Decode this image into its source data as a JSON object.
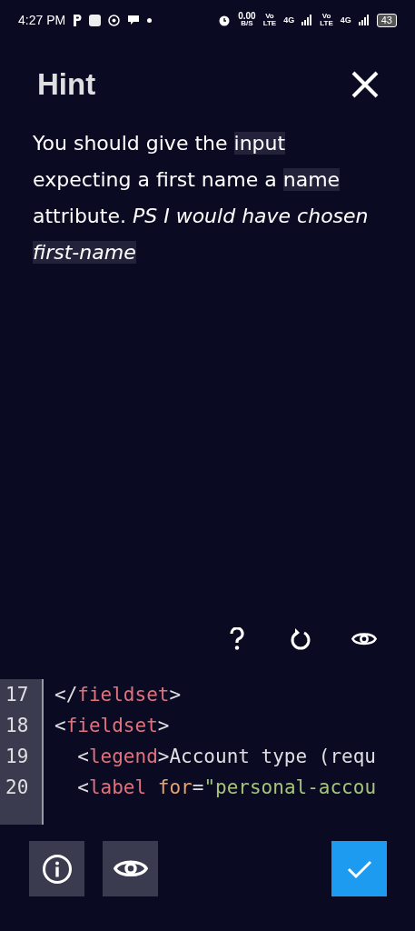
{
  "status_bar": {
    "time": "4:27 PM",
    "speed": "0.00",
    "speed_unit": "B/S",
    "sim_1": {
      "vo": "Vo",
      "lte": "LTE",
      "net": "4G"
    },
    "sim_2": {
      "vo": "Vo",
      "lte": "LTE",
      "net": "4G"
    },
    "battery": "43"
  },
  "hint": {
    "title": "Hint",
    "segments": [
      {
        "kind": "plain",
        "text": "You should give the "
      },
      {
        "kind": "code",
        "text": "input"
      },
      {
        "kind": "plain",
        "text": " expecting a first name a "
      },
      {
        "kind": "code",
        "text": "name"
      },
      {
        "kind": "plain",
        "text": " attribute. "
      },
      {
        "kind": "italic",
        "text": "PS I would have chosen "
      },
      {
        "kind": "italic-code",
        "text": "first-name"
      }
    ]
  },
  "editor": {
    "lines": [
      {
        "number": "17",
        "tokens": [
          {
            "kind": "punct",
            "text": "</"
          },
          {
            "kind": "tag",
            "text": "fieldset"
          },
          {
            "kind": "punct",
            "text": ">"
          }
        ]
      },
      {
        "number": "18",
        "tokens": [
          {
            "kind": "punct",
            "text": "<"
          },
          {
            "kind": "tag",
            "text": "fieldset"
          },
          {
            "kind": "punct",
            "text": ">"
          }
        ]
      },
      {
        "number": "19",
        "tokens": [
          {
            "kind": "punct",
            "text": "  <"
          },
          {
            "kind": "tag",
            "text": "legend"
          },
          {
            "kind": "punct",
            "text": ">Account type (requ"
          }
        ]
      },
      {
        "number": "20",
        "tokens": [
          {
            "kind": "punct",
            "text": "  <"
          },
          {
            "kind": "tag",
            "text": "label"
          },
          {
            "kind": "attr",
            "text": " for"
          },
          {
            "kind": "punct",
            "text": "="
          },
          {
            "kind": "string",
            "text": "\"personal-accou"
          }
        ]
      }
    ]
  }
}
